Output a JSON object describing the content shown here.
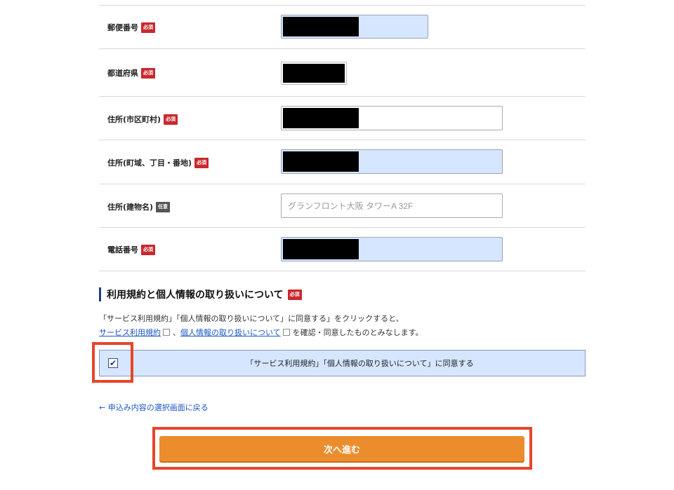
{
  "badges": {
    "required": "必須",
    "optional": "任意"
  },
  "form": {
    "rows": [
      {
        "label": "郵便番号",
        "badge": "required",
        "value": ""
      },
      {
        "label": "都道府県",
        "badge": "required",
        "value": ""
      },
      {
        "label": "住所(市区町村)",
        "badge": "required",
        "value": ""
      },
      {
        "label": "住所(町域、丁目・番地)",
        "badge": "required",
        "value": ""
      },
      {
        "label": "住所(建物名)",
        "badge": "optional",
        "value": "",
        "placeholder": "グランフロント大阪 タワーA 32F"
      },
      {
        "label": "電話番号",
        "badge": "required",
        "value": ""
      }
    ]
  },
  "terms": {
    "title": "利用規約と個人情報の取り扱いについて",
    "badge": "必須",
    "note_line1": "「サービス利用規約」「個人情報の取り扱いについて」に同意する」をクリックすると、",
    "link_service": "サービス利用規約",
    "separator": "、",
    "link_privacy": "個人情報の取り扱いについて",
    "note_suffix": "を確認・同意したものとみなします。",
    "consent_label": "「サービス利用規約」「個人情報の取り扱いについて」に同意する",
    "checked": true
  },
  "actions": {
    "back_label": "← 申込み内容の選択画面に戻る",
    "next_label": "次へ進む"
  },
  "colors": {
    "field_bg": "#d6e6ff",
    "required_badge": "#c9282d",
    "optional_badge": "#555555",
    "primary_button": "#ec8d2d",
    "annotation_red": "#e8452b",
    "link": "#1a55c4"
  }
}
